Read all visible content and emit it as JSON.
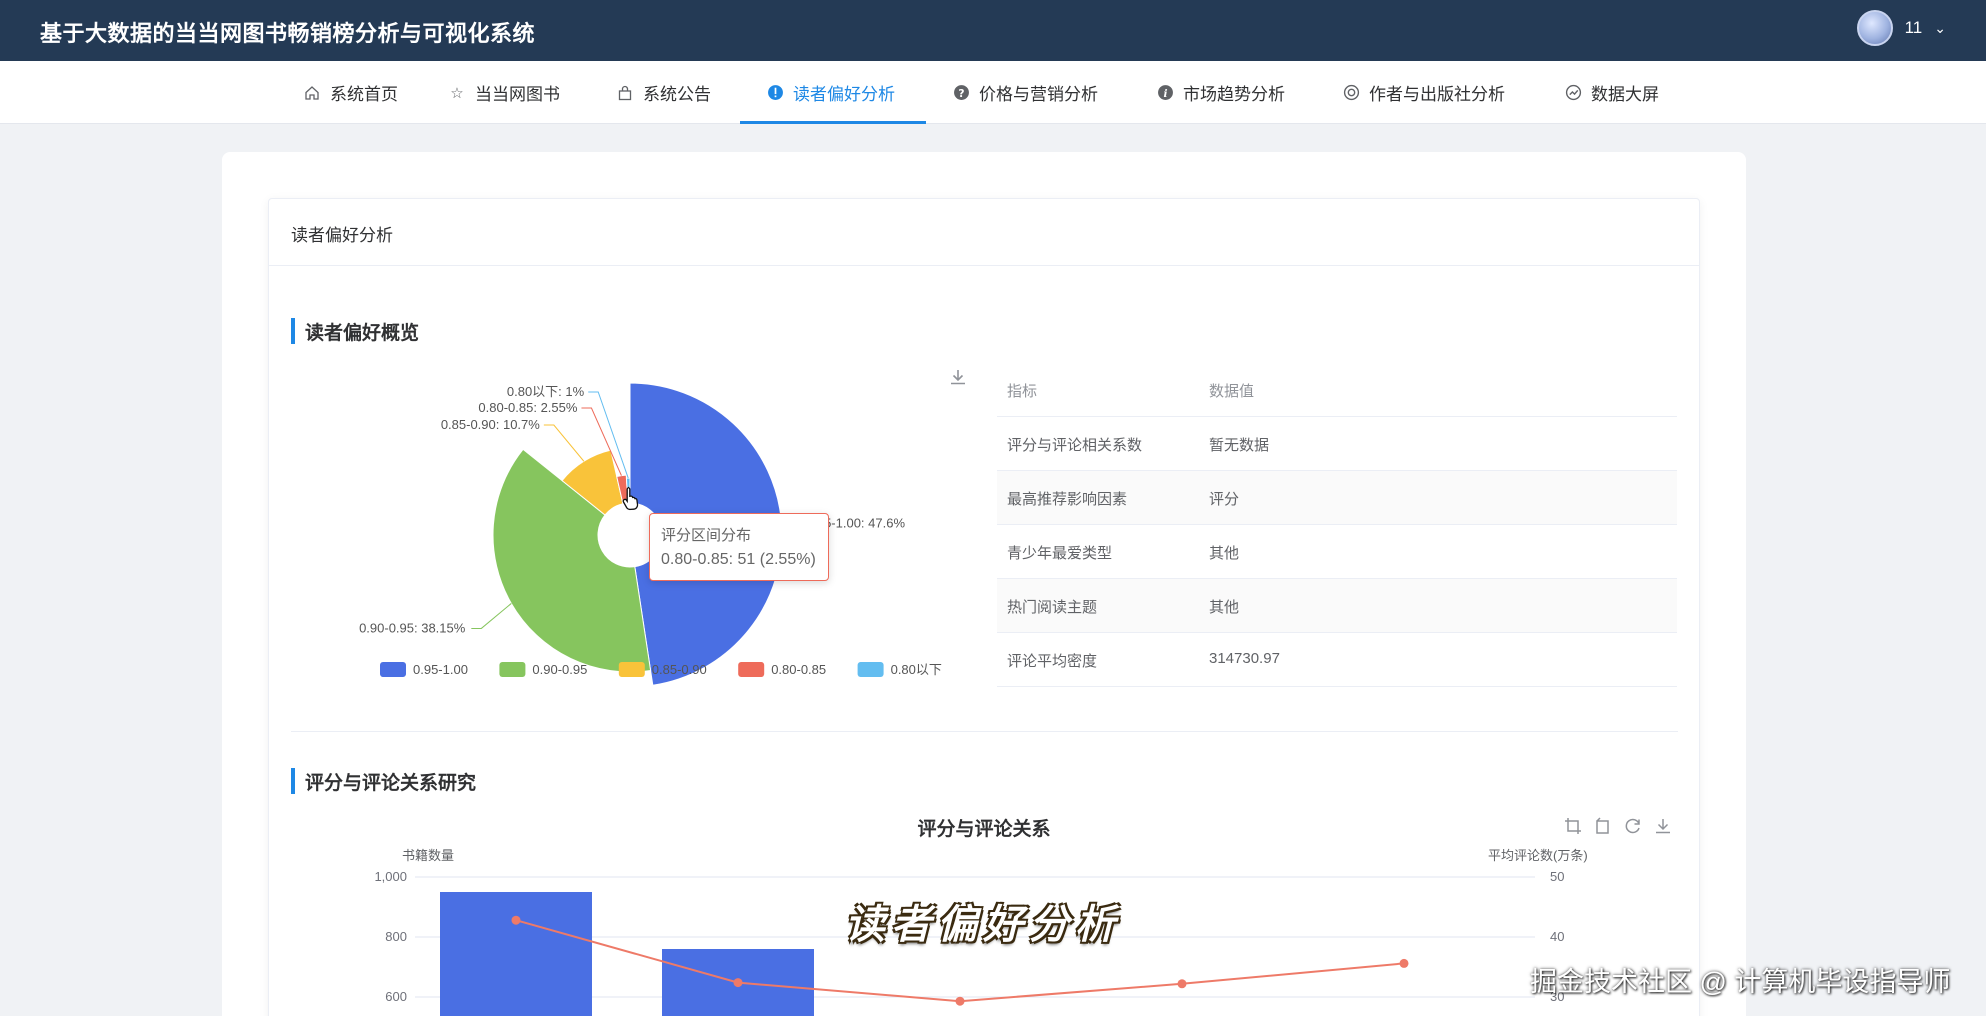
{
  "app": {
    "title": "基于大数据的当当网图书畅销榜分析与可视化系统"
  },
  "user": {
    "name": "11"
  },
  "nav": {
    "items": [
      {
        "label": "系统首页",
        "icon": "home-icon"
      },
      {
        "label": "当当网图书",
        "icon": "star-icon"
      },
      {
        "label": "系统公告",
        "icon": "bag-icon"
      },
      {
        "label": "读者偏好分析",
        "icon": "info-circle-icon",
        "active": true
      },
      {
        "label": "价格与营销分析",
        "icon": "question-circle-icon"
      },
      {
        "label": "市场趋势分析",
        "icon": "info-icon"
      },
      {
        "label": "作者与出版社分析",
        "icon": "copyright-icon"
      },
      {
        "label": "数据大屏",
        "icon": "dashboard-icon"
      }
    ]
  },
  "panel": {
    "title": "读者偏好分析"
  },
  "sections": {
    "overview": "读者偏好概览",
    "relation": "评分与评论关系研究"
  },
  "pie_tooltip": {
    "title": "评分区间分布",
    "value": "0.80-0.85: 51 (2.55%)"
  },
  "stats_table": {
    "headers": [
      "指标",
      "数据值"
    ],
    "rows": [
      [
        "评分与评论相关系数",
        "暂无数据"
      ],
      [
        "最高推荐影响因素",
        "评分"
      ],
      [
        "青少年最爱类型",
        "其他"
      ],
      [
        "热门阅读主题",
        "其他"
      ],
      [
        "评论平均密度",
        "314730.97"
      ]
    ]
  },
  "colors": {
    "accent": "#1e88e5",
    "header_bg": "#243a55",
    "blue": "#4a6fe3",
    "green": "#86c55e",
    "yellow": "#f9c33a",
    "red": "#ee6b5a",
    "cyan": "#63bdf0"
  },
  "overlay": {
    "subtitle": "读者偏好分析",
    "watermark": "掘金技术社区 @ 计算机毕设指导师"
  },
  "chart_data": [
    {
      "type": "pie",
      "title": "",
      "series_name": "评分区间分布",
      "slices": [
        {
          "label": "0.95-1.00",
          "percent": 47.6,
          "color": "#4a6fe3"
        },
        {
          "label": "0.90-0.95",
          "percent": 38.15,
          "color": "#86c55e"
        },
        {
          "label": "0.85-0.90",
          "percent": 10.7,
          "color": "#f9c33a"
        },
        {
          "label": "0.80-0.85",
          "percent": 2.55,
          "count": 51,
          "color": "#ee6b5a"
        },
        {
          "label": "0.80以下",
          "percent": 1,
          "color": "#63bdf0"
        }
      ],
      "slice_labels": [
        "0.95-1.00: 47.6%",
        "0.90-0.95: 38.15%",
        "0.85-0.90: 10.7%",
        "0.80-0.85: 2.55%",
        "0.80以下: 1%"
      ],
      "legend": [
        "0.95-1.00",
        "0.90-0.95",
        "0.85-0.90",
        "0.80-0.85",
        "0.80以下"
      ],
      "legend_position": "bottom",
      "rose": true
    },
    {
      "type": "bar",
      "title": "评分与评论关系",
      "ylabel": "书籍数量",
      "ylabel_right": "平均评论数(万条)",
      "y_ticks": [
        "1,000",
        "800",
        "600"
      ],
      "y_ticks_right": [
        "50",
        "40",
        "30"
      ],
      "ylim_visible": [
        600,
        1000
      ],
      "ylim_right_visible": [
        30,
        50
      ],
      "series": [
        {
          "kind": "bar",
          "color": "#4a6fe3",
          "values": [
            950,
            760
          ]
        },
        {
          "kind": "line",
          "color": "#ee7a68",
          "values": [
            42.8,
            32.4,
            29.3,
            32.2,
            35.6
          ]
        }
      ]
    }
  ]
}
